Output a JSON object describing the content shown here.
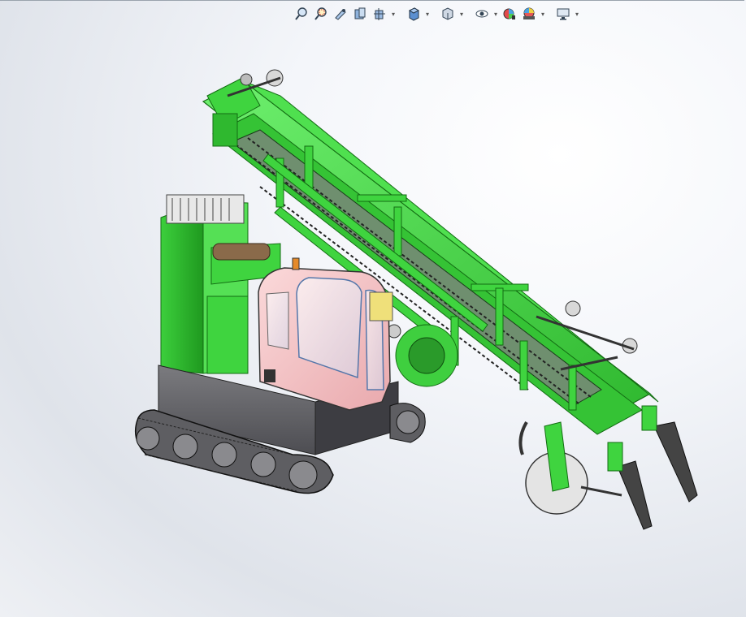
{
  "app": {
    "accent_green": "#3fd43f",
    "cab_color": "#f2c6c8",
    "chassis_color": "#5a5a5e"
  },
  "toolbar": {
    "items": [
      {
        "icon": "zoom-to-fit-icon",
        "dropdown": false
      },
      {
        "icon": "zoom-to-area-icon",
        "dropdown": false
      },
      {
        "icon": "previous-view-icon",
        "dropdown": false
      },
      {
        "icon": "section-view-icon",
        "dropdown": false
      },
      {
        "icon": "dynamic-annotation-views-icon",
        "dropdown": true
      },
      {
        "icon": "view-orientation-icon",
        "dropdown": true
      },
      {
        "icon": "display-style-icon",
        "dropdown": true
      },
      {
        "icon": "hide-show-items-icon",
        "dropdown": false
      },
      {
        "icon": "edit-appearance-icon",
        "dropdown": false
      },
      {
        "icon": "apply-scene-icon",
        "dropdown": true
      },
      {
        "icon": "view-settings-icon",
        "dropdown": true
      }
    ]
  },
  "viewport": {
    "model_name": "crawler-harvester-assembly",
    "view": "isometric"
  }
}
